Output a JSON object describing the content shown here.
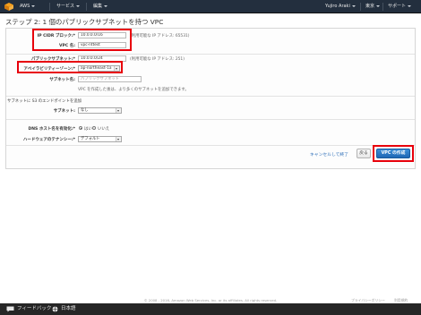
{
  "topbar": {
    "brand": "AWS",
    "services": "サービス",
    "edit": "編集",
    "user": "Yujiro Araki",
    "region": "東京",
    "support": "サポート"
  },
  "page_title": "ステップ 2: 1 個のパブリックサブネットを持つ VPC",
  "form": {
    "cidr_label": "IP CIDR ブロック:*",
    "cidr_value": "10.0.0.0/16",
    "cidr_hint": "(利用可能な IP アドレス: 65531)",
    "vpc_name_label": "VPC 名:",
    "vpc_name_value": "vpc-nttest",
    "subnet_label": "パブリックサブネット:*",
    "subnet_value": "10.0.0.0/24",
    "subnet_hint": "(利用可能な IP アドレス: 251)",
    "az_label": "アベイラビリティーゾーン:*",
    "az_value": "ap-northeast-1a",
    "subnet_name_label": "サブネット名:",
    "subnet_name_placeholder": "パブリックサブネット",
    "subnet_note": "VPC を作成した後は、より多くのサブネットを追加できます。",
    "s3_endpoint_title": "サブネットに S3 のエンドポイントを追加",
    "s3_subnet_label": "サブネット:",
    "s3_subnet_value": "なし",
    "dns_label": "DNS ホスト名を有効化:*",
    "dns_yes": "はい",
    "dns_no": "いいえ",
    "tenancy_label": "ハードウェアのテナンシー:*",
    "tenancy_value": "デフォルト"
  },
  "actions": {
    "cancel_exit": "キャンセルして終了",
    "back": "戻る",
    "create_vpc": "VPC の作成"
  },
  "footer": {
    "copyright": "© 2008 - 2016, Amazon Web Services, Inc. or its affiliates. All rights reserved.",
    "privacy": "プライバシーポリシー",
    "terms": "利用規約",
    "feedback": "フィードバック",
    "language": "日本語"
  },
  "colors": {
    "highlight": "#e8000b",
    "primary": "#1f67b4",
    "topbar": "#232f3e"
  }
}
